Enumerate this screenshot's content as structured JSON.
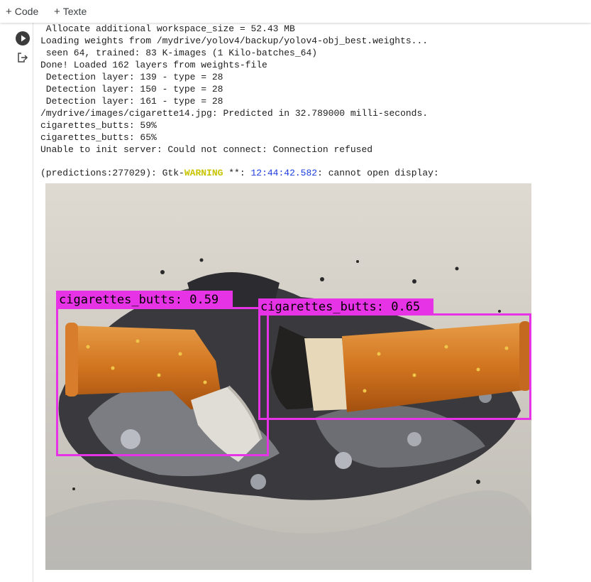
{
  "toolbar": {
    "add_code": "Code",
    "add_text": "Texte"
  },
  "output": {
    "lines": [
      " Allocate additional workspace_size = 52.43 MB",
      "Loading weights from /mydrive/yolov4/backup/yolov4-obj_best.weights...",
      " seen 64, trained: 83 K-images (1 Kilo-batches_64)",
      "Done! Loaded 162 layers from weights-file",
      " Detection layer: 139 - type = 28",
      " Detection layer: 150 - type = 28",
      " Detection layer: 161 - type = 28",
      "/mydrive/images/cigarette14.jpg: Predicted in 32.789000 milli-seconds.",
      "cigarettes_butts: 59%",
      "cigarettes_butts: 65%",
      "Unable to init server: Could not connect: Connection refused"
    ],
    "warning": {
      "prefix": "(predictions:277029): Gtk-",
      "keyword": "WARNING",
      "middle": " **: ",
      "timestamp": "12:44:42.582",
      "suffix": ": cannot open display:"
    }
  },
  "detections": [
    {
      "label": "cigarettes_butts: 0.59"
    },
    {
      "label": "cigarettes_butts: 0.65"
    }
  ],
  "colors": {
    "box": "#e633e6",
    "warning": "#c9c400",
    "timestamp": "#1e3ce0"
  },
  "icons": [
    "plus-icon",
    "play-icon",
    "output-redirect-icon"
  ]
}
